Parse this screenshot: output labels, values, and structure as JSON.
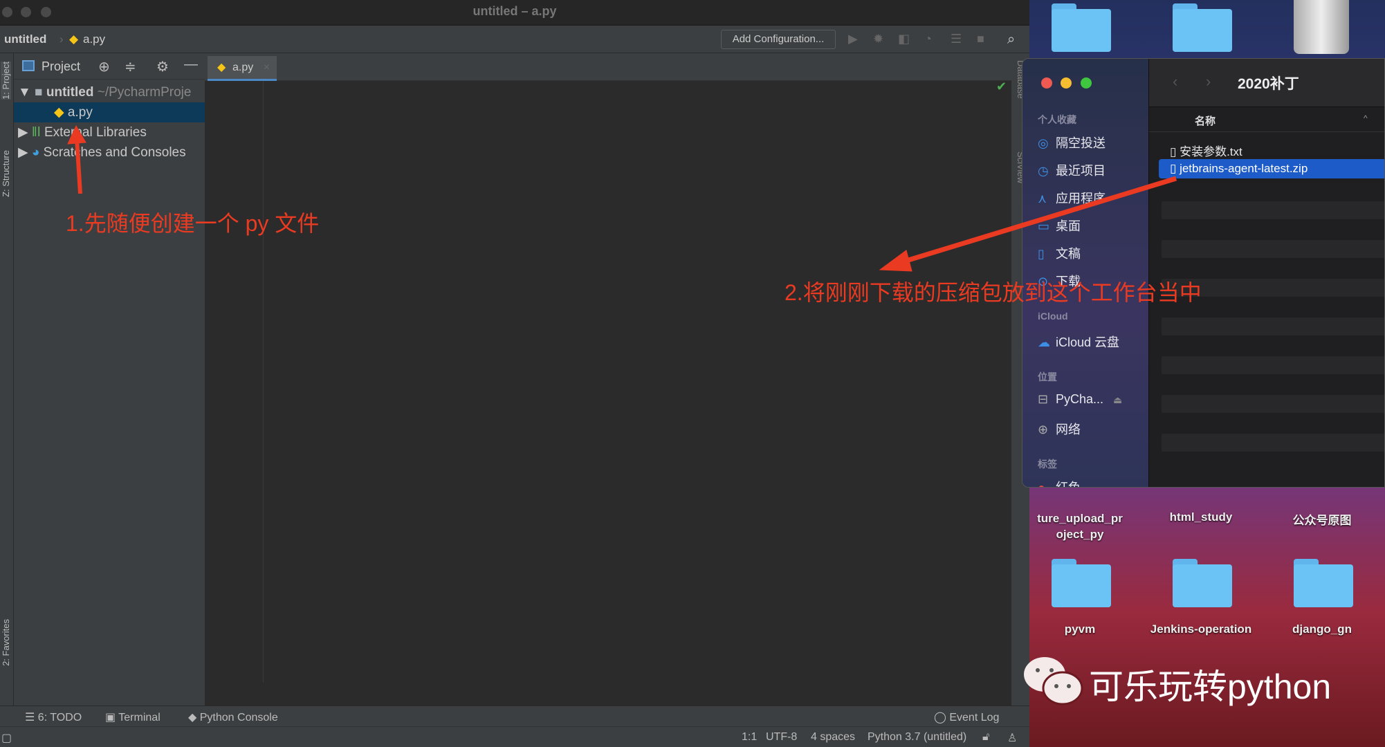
{
  "window": {
    "title": "untitled – a.py"
  },
  "navbar": {
    "project": "untitled",
    "file": "a.py",
    "add_config": "Add Configuration..."
  },
  "tool_strip": {
    "project": "1: Project",
    "structure": "Z: Structure",
    "favorites": "2: Favorites"
  },
  "project_panel": {
    "header": "Project",
    "tree": [
      {
        "label": "untitled",
        "path": "~/PycharmProje"
      },
      {
        "label": "a.py"
      },
      {
        "label": "External Libraries"
      },
      {
        "label": "Scratches and Consoles"
      }
    ]
  },
  "editor": {
    "tab": "a.py"
  },
  "right_strip": {
    "database": "Database",
    "sciview": "SciView"
  },
  "bottom_tools": {
    "todo": "6: TODO",
    "terminal": "Terminal",
    "console": "Python Console",
    "event_log": "Event Log"
  },
  "status": {
    "position": "1:1",
    "encoding": "UTF-8",
    "indent": "4 spaces",
    "interpreter": "Python 3.7 (untitled)"
  },
  "finder": {
    "title": "2020补丁",
    "column": "名称",
    "sections": {
      "favorites": "个人收藏",
      "icloud": "iCloud",
      "locations": "位置",
      "tags": "标签"
    },
    "favorites": [
      "隔空投送",
      "最近项目",
      "应用程序",
      "桌面",
      "文稿",
      "下载"
    ],
    "icloud_items": [
      "iCloud 云盘"
    ],
    "locations": [
      "PyCha...",
      "网络"
    ],
    "tags": [
      "红色"
    ],
    "files": [
      "安装参数.txt",
      "jetbrains-agent-latest.zip"
    ],
    "selected_file": "jetbrains-agent-latest.zip"
  },
  "desktop": {
    "row1": [
      "ture_upload_pr\noject_py",
      "html_study",
      "公众号原图"
    ],
    "row2": [
      "pyvm",
      "Jenkins-operation",
      "django_gn"
    ]
  },
  "annotations": {
    "step1": "1.先随便创建一个 py 文件",
    "step2": "2.将刚刚下载的压缩包放到这个工作台当中",
    "color": "#ea3b22"
  },
  "watermark": "可乐玩转python"
}
